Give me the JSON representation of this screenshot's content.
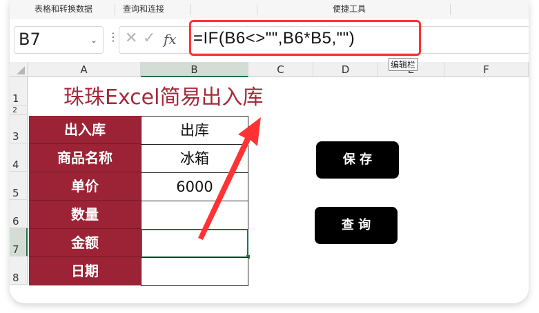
{
  "ribbon": {
    "items": [
      "表格和转换数据",
      "查询和连接",
      "便捷工具"
    ]
  },
  "formula_bar": {
    "name_box": "B7",
    "cancel_glyph": "✕",
    "enter_glyph": "✓",
    "fx_label": "fx",
    "formula": "=IF(B6<>\"\",B6*B5,\"\")",
    "tooltip": "编辑栏"
  },
  "columns": [
    "A",
    "B",
    "C",
    "D",
    "E",
    "F"
  ],
  "rows": [
    "1",
    "2",
    "3",
    "4",
    "5",
    "6",
    "7",
    "8"
  ],
  "sheet": {
    "title": "珠珠Excel简易出入库",
    "fields": [
      {
        "label": "出入库",
        "value": "出库"
      },
      {
        "label": "商品名称",
        "value": "冰箱"
      },
      {
        "label": "单价",
        "value": "6000"
      },
      {
        "label": "数量",
        "value": ""
      },
      {
        "label": "金额",
        "value": ""
      },
      {
        "label": "日期",
        "value": ""
      }
    ],
    "selected_cell": "B7"
  },
  "buttons": {
    "save": "保 存",
    "query": "查 询"
  },
  "colors": {
    "label_fill": "#9b2335",
    "title_color": "#a52a3a",
    "highlight": "#ff3333",
    "selection": "#217346"
  }
}
